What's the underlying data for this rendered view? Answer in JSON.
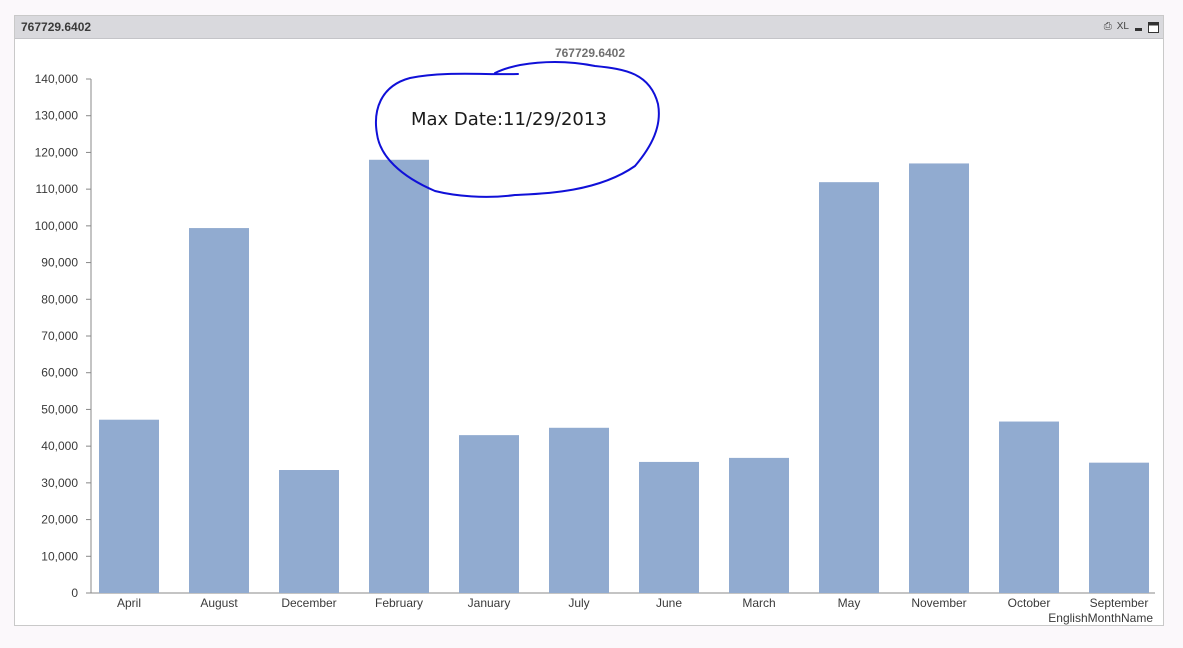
{
  "window": {
    "title": "767729.6402",
    "controls": {
      "print_label": "⎙",
      "xl_label": "XL"
    }
  },
  "colors": {
    "bar": "#91abd0",
    "annotation_ink": "#1010d8"
  },
  "annotation": {
    "text": "Max Date:11/29/2013"
  },
  "chart_data": {
    "type": "bar",
    "title": "767729.6402",
    "xlabel": "EnglishMonthName",
    "ylabel": "",
    "categories": [
      "April",
      "August",
      "December",
      "February",
      "January",
      "July",
      "June",
      "March",
      "May",
      "November",
      "October",
      "September"
    ],
    "values": [
      47200,
      99400,
      33500,
      118000,
      43000,
      45000,
      35700,
      36800,
      111900,
      117000,
      46700,
      35500
    ],
    "ylim": [
      0,
      140000
    ],
    "yticks": [
      0,
      10000,
      20000,
      30000,
      40000,
      50000,
      60000,
      70000,
      80000,
      90000,
      100000,
      110000,
      120000,
      130000,
      140000
    ],
    "ytick_labels": [
      "0",
      "10,000",
      "20,000",
      "30,000",
      "40,000",
      "50,000",
      "60,000",
      "70,000",
      "80,000",
      "90,000",
      "100,000",
      "110,000",
      "120,000",
      "130,000",
      "140,000"
    ],
    "grid": false,
    "legend": "none"
  }
}
